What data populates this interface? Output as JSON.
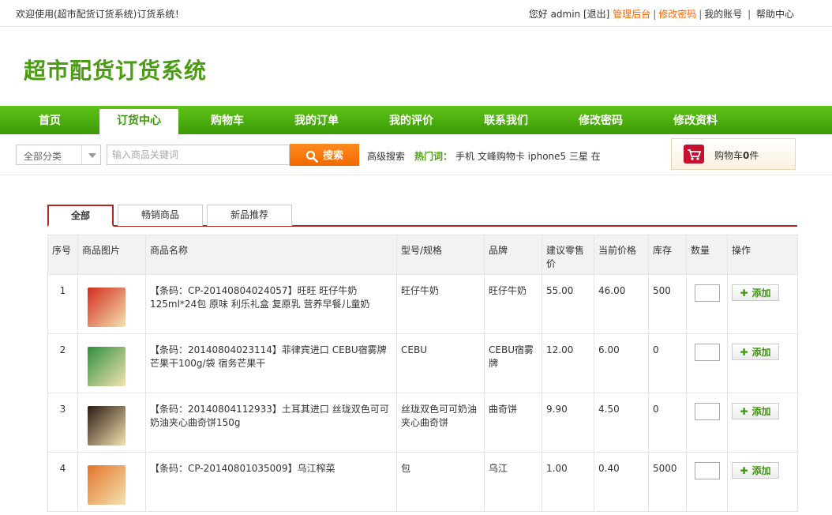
{
  "topbar": {
    "welcome": "欢迎使用(超市配货订货系统)订货系统！",
    "greeting": "您好 admin [退出]",
    "admin_link": "管理后台",
    "change_pwd_link": "修改密码",
    "my_account": "我的账号",
    "help": "帮助中心"
  },
  "logo": "超市配货订货系统",
  "nav": [
    "首页",
    "订货中心",
    "购物车",
    "我的订单",
    "我的评价",
    "联系我们",
    "修改密码",
    "修改资料"
  ],
  "search": {
    "category": "全部分类",
    "placeholder": "输入商品关键词",
    "button": "搜索",
    "advanced": "高级搜索",
    "hot_label": "热门词：",
    "hot_words": "手机 文峰购物卡 iphone5 三星 在"
  },
  "cart": {
    "label": "购物车",
    "count": "0",
    "unit": "件"
  },
  "tabs": [
    "全部",
    "畅销商品",
    "新品推荐"
  ],
  "table": {
    "headers": [
      "序号",
      "商品图片",
      "商品名称",
      "型号/规格",
      "品牌",
      "建议零售价",
      "当前价格",
      "库存",
      "数量",
      "操作"
    ],
    "add_label": "添加",
    "rows": [
      {
        "idx": "1",
        "name": "【条码：CP-20140804024057】旺旺 旺仔牛奶125ml*24包 原味 利乐礼盒 复原乳 营养早餐儿童奶",
        "spec": "旺仔牛奶",
        "brand": "旺仔牛奶",
        "retail": "55.00",
        "price": "46.00",
        "stock": "500",
        "img_color": "#d32b1e"
      },
      {
        "idx": "2",
        "name": "【条码：20140804023114】菲律宾进口 CEBU宿雾牌芒果干100g/袋 宿务芒果干",
        "spec": "CEBU",
        "brand": "CEBU宿雾牌",
        "retail": "12.00",
        "price": "6.00",
        "stock": "0",
        "img_color": "#2f8f3e"
      },
      {
        "idx": "3",
        "name": "【条码：20140804112933】土耳其进口 丝珑双色可可奶油夹心曲奇饼150g",
        "spec": "丝珑双色可可奶油夹心曲奇饼",
        "brand": "曲奇饼",
        "retail": "9.90",
        "price": "4.50",
        "stock": "0",
        "img_color": "#2a1a14"
      },
      {
        "idx": "4",
        "name": "【条码：CP-20140801035009】乌江榨菜",
        "spec": "包",
        "brand": "乌江",
        "retail": "1.00",
        "price": "0.40",
        "stock": "5000",
        "img_color": "#e3742a"
      }
    ]
  }
}
